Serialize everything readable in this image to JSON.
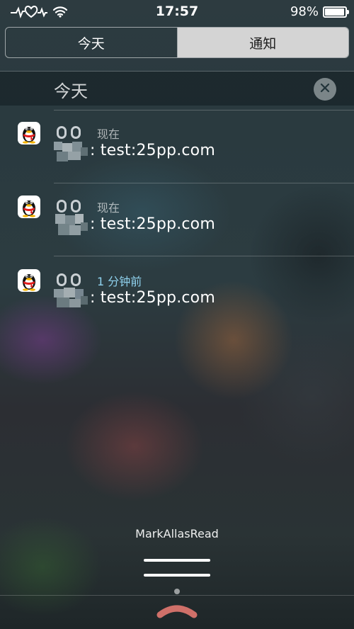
{
  "status_bar": {
    "time": "17:57",
    "battery_text": "98%",
    "battery_level": 0.98,
    "icons": [
      "heartbeat-icon",
      "wifi-icon",
      "battery-icon"
    ]
  },
  "segments": {
    "today_label": "今天",
    "notifications_label": "通知",
    "selected": "notifications"
  },
  "section": {
    "title": "今天",
    "clear_icon": "close-icon"
  },
  "notifications": [
    {
      "app_icon": "qq-penguin-icon",
      "time": "现在",
      "message": ": test:25pp.com",
      "sender_pixelated": true
    },
    {
      "app_icon": "qq-penguin-icon",
      "time": "现在",
      "message": ": test:25pp.com",
      "sender_pixelated": true
    },
    {
      "app_icon": "qq-penguin-icon",
      "time": "1 分钟前",
      "message": ": test:25pp.com",
      "sender_pixelated": true
    }
  ],
  "footer": {
    "mark_all_label": "MarkAllasRead",
    "handle_icons": [
      "grabber-icon",
      "chevron-up-icon"
    ]
  },
  "colors": {
    "recent_time": "#8fd2ee",
    "segment_selected_bg": "#f0eeec",
    "penguin_black": "#111111",
    "penguin_beak": "#f5b300",
    "penguin_scarf": "#e21e1e",
    "chevron": "#cf7069"
  }
}
